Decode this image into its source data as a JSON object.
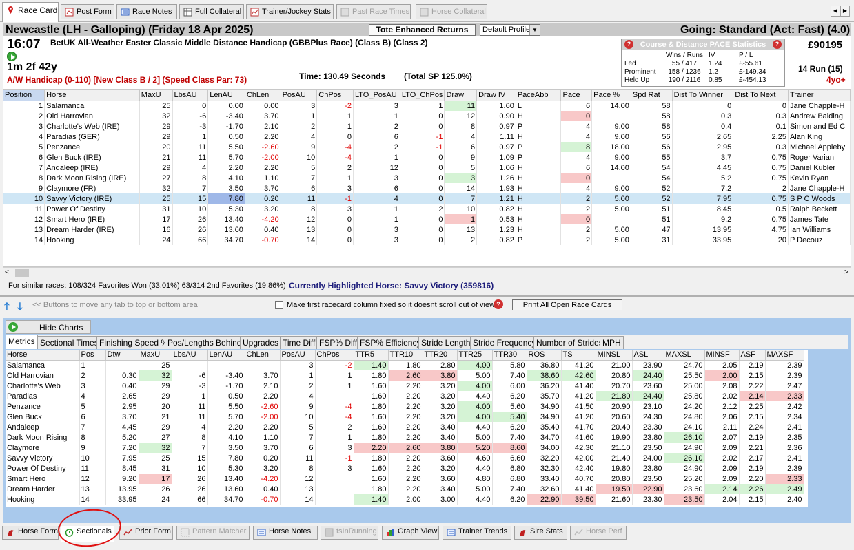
{
  "top_tabs": [
    {
      "label": "Race Card",
      "icon": "location-pin-icon",
      "active": true
    },
    {
      "label": "Post Form",
      "icon": "form-icon"
    },
    {
      "label": "Race Notes",
      "icon": "notes-icon"
    },
    {
      "label": "Full Collateral",
      "icon": "table-icon"
    },
    {
      "label": "Trainer/Jockey Stats",
      "icon": "chart-icon"
    },
    {
      "label": "Past Race Times",
      "icon": "grid-icon",
      "disabled": true
    },
    {
      "label": "Horse Collateral",
      "icon": "grid-icon",
      "disabled": true
    }
  ],
  "header": {
    "course": "Newcastle (LH - Galloping)  (Friday 18 Apr 2025)",
    "tote_button": "Tote Enhanced Returns",
    "profile_select": "Default Profile",
    "going": "Going: Standard (Act: Fast) (4.0)",
    "time": "16:07",
    "race_title": "BetUK All-Weather Easter Classic Middle Distance Handicap (GBBPlus Race) (Class B) (Class 2)",
    "distance": "1m 2f 42y",
    "class_line": "A/W Handicap (0-110) [New Class B / 2]  (Speed Class Par: 73)",
    "race_time": "Time: 130.49 Seconds",
    "total_sp": "(Total SP 125.0%)",
    "prize": "£90195",
    "runners": "14 Run (15)",
    "age": "4yo+"
  },
  "pace_stats": {
    "title": "Course & Distance PACE Statistics",
    "headers": [
      "",
      "Wins / Runs",
      "IV",
      "P / L"
    ],
    "rows": [
      [
        "Led",
        "55 / 417",
        "1.24",
        "£-55.61"
      ],
      [
        "Prominent",
        "158 / 1236",
        "1.2",
        "£-149.34"
      ],
      [
        "Held Up",
        "190 / 2116",
        "0.85",
        "£-454.13"
      ]
    ]
  },
  "racecard": {
    "columns": [
      "Position",
      "Horse",
      "MaxU",
      "LbsAU",
      "LenAU",
      "ChLen",
      "PosAU",
      "ChPos",
      "LTO_PosAU",
      "LTO_ChPos",
      "Draw",
      "Draw IV",
      "PaceAbb",
      "Pace",
      "Pace %",
      "Spd Rat",
      "Dist To Winner",
      "Dist To Next",
      "Trainer"
    ],
    "rows": [
      [
        "1",
        "Salamanca",
        "25",
        "0",
        "0.00",
        "0.00",
        "3",
        "-2",
        "3",
        "1",
        "11",
        "1.60",
        "L",
        "6",
        "14.00",
        "58",
        "0",
        "0",
        "Jane Chapple-H"
      ],
      [
        "2",
        "Old Harrovian",
        "32",
        "-6",
        "-3.40",
        "3.70",
        "1",
        "1",
        "1",
        "0",
        "12",
        "0.90",
        "H",
        "0",
        "",
        "58",
        "0.3",
        "0.3",
        "Andrew Balding"
      ],
      [
        "3",
        "Charlotte's Web (IRE)",
        "29",
        "-3",
        "-1.70",
        "2.10",
        "2",
        "1",
        "2",
        "0",
        "8",
        "0.97",
        "P",
        "4",
        "9.00",
        "58",
        "0.4",
        "0.1",
        "Simon and Ed C"
      ],
      [
        "4",
        "Paradias (GER)",
        "29",
        "1",
        "0.50",
        "2.20",
        "4",
        "0",
        "6",
        "-1",
        "4",
        "1.11",
        "H",
        "4",
        "9.00",
        "56",
        "2.65",
        "2.25",
        "Alan King"
      ],
      [
        "5",
        "Penzance",
        "20",
        "11",
        "5.50",
        "-2.60",
        "9",
        "-4",
        "2",
        "-1",
        "6",
        "0.97",
        "P",
        "8",
        "18.00",
        "56",
        "2.95",
        "0.3",
        "Michael Appleby"
      ],
      [
        "6",
        "Glen Buck (IRE)",
        "21",
        "11",
        "5.70",
        "-2.00",
        "10",
        "-4",
        "1",
        "0",
        "9",
        "1.09",
        "P",
        "4",
        "9.00",
        "55",
        "3.7",
        "0.75",
        "Roger Varian"
      ],
      [
        "7",
        "Andaleep (IRE)",
        "29",
        "4",
        "2.20",
        "2.20",
        "5",
        "2",
        "12",
        "0",
        "5",
        "1.06",
        "H",
        "6",
        "14.00",
        "54",
        "4.45",
        "0.75",
        "Daniel Kubler"
      ],
      [
        "8",
        "Dark Moon Rising (IRE)",
        "27",
        "8",
        "4.10",
        "1.10",
        "7",
        "1",
        "3",
        "0",
        "3",
        "1.26",
        "H",
        "0",
        "",
        "54",
        "5.2",
        "0.75",
        "Kevin Ryan"
      ],
      [
        "9",
        "Claymore (FR)",
        "32",
        "7",
        "3.50",
        "3.70",
        "6",
        "3",
        "6",
        "0",
        "14",
        "1.93",
        "H",
        "4",
        "9.00",
        "52",
        "7.2",
        "2",
        "Jane Chapple-H"
      ],
      [
        "10",
        "Savvy Victory (IRE)",
        "25",
        "15",
        "7.80",
        "0.20",
        "11",
        "-1",
        "4",
        "0",
        "7",
        "1.21",
        "H",
        "2",
        "5.00",
        "52",
        "7.95",
        "0.75",
        "S P C Woods"
      ],
      [
        "11",
        "Power Of Destiny",
        "31",
        "10",
        "5.30",
        "3.20",
        "8",
        "3",
        "1",
        "2",
        "10",
        "0.82",
        "H",
        "2",
        "5.00",
        "51",
        "8.45",
        "0.5",
        "Ralph Beckett"
      ],
      [
        "12",
        "Smart Hero (IRE)",
        "17",
        "26",
        "13.40",
        "-4.20",
        "12",
        "0",
        "1",
        "0",
        "1",
        "0.53",
        "H",
        "0",
        "",
        "51",
        "9.2",
        "0.75",
        "James Tate"
      ],
      [
        "13",
        "Dream Harder (IRE)",
        "16",
        "26",
        "13.60",
        "0.40",
        "13",
        "0",
        "3",
        "0",
        "13",
        "1.23",
        "H",
        "2",
        "5.00",
        "47",
        "13.95",
        "4.75",
        "Ian Williams"
      ],
      [
        "14",
        "Hooking",
        "24",
        "66",
        "34.70",
        "-0.70",
        "14",
        "0",
        "3",
        "0",
        "2",
        "0.82",
        "P",
        "2",
        "5.00",
        "31",
        "33.95",
        "20",
        "P Decouz"
      ]
    ]
  },
  "similar_races": "For similar races: 108/324 Favorites Won (33.01%) 63/314 2nd Favorites (19.86%)",
  "highlighted_horse": "Currently Highlighted Horse:  Savvy Victory (359816)",
  "move_hint": "<< Buttons to move any tab to top or bottom area",
  "fixed_col_label": "Make first racecard column fixed so it doesnt scroll out of view",
  "print_button": "Print All Open Race Cards",
  "hide_charts": "Hide Charts",
  "sub_tabs": [
    "Metrics",
    "Sectional Times",
    "Finishing Speed %",
    "Pos/Lengths Behind",
    "Upgrades",
    "Time Diff",
    "FSP% Diff",
    "FSP% Efficiency",
    "Stride Length",
    "Stride Frequency",
    "Number of Strides",
    "MPH"
  ],
  "metrics": {
    "columns": [
      "Horse",
      "Pos",
      "Dtw",
      "MaxU",
      "LbsAU",
      "LenAU",
      "ChLen",
      "PosAU",
      "ChPos",
      "TTR5",
      "TTR10",
      "TTR20",
      "TTR25",
      "TTR30",
      "ROS",
      "TS",
      "MINSL",
      "ASL",
      "MAXSL",
      "MINSF",
      "ASF",
      "MAXSF"
    ],
    "rows": [
      [
        "Salamanca",
        "1",
        "",
        "25",
        "",
        "",
        "",
        "3",
        "-2",
        "1.40",
        "1.80",
        "2.80",
        "4.00",
        "5.80",
        "36.80",
        "41.20",
        "21.00",
        "23.90",
        "24.70",
        "2.05",
        "2.19",
        "2.39"
      ],
      [
        "Old Harrovian",
        "2",
        "0.30",
        "32",
        "-6",
        "-3.40",
        "3.70",
        "1",
        "1",
        "1.80",
        "2.60",
        "3.80",
        "5.00",
        "7.40",
        "38.60",
        "42.60",
        "20.80",
        "24.40",
        "25.50",
        "2.00",
        "2.15",
        "2.39"
      ],
      [
        "Charlotte's Web",
        "3",
        "0.40",
        "29",
        "-3",
        "-1.70",
        "2.10",
        "2",
        "1",
        "1.60",
        "2.20",
        "3.20",
        "4.00",
        "6.00",
        "36.20",
        "41.40",
        "20.70",
        "23.60",
        "25.00",
        "2.08",
        "2.22",
        "2.47"
      ],
      [
        "Paradias",
        "4",
        "2.65",
        "29",
        "1",
        "0.50",
        "2.20",
        "4",
        "",
        "1.60",
        "2.20",
        "3.20",
        "4.40",
        "6.20",
        "35.70",
        "41.20",
        "21.80",
        "24.40",
        "25.80",
        "2.02",
        "2.14",
        "2.33"
      ],
      [
        "Penzance",
        "5",
        "2.95",
        "20",
        "11",
        "5.50",
        "-2.60",
        "9",
        "-4",
        "1.80",
        "2.20",
        "3.20",
        "4.00",
        "5.60",
        "34.90",
        "41.50",
        "20.90",
        "23.10",
        "24.20",
        "2.12",
        "2.25",
        "2.42"
      ],
      [
        "Glen Buck",
        "6",
        "3.70",
        "21",
        "11",
        "5.70",
        "-2.00",
        "10",
        "-4",
        "1.60",
        "2.20",
        "3.20",
        "4.00",
        "5.40",
        "34.90",
        "41.20",
        "20.60",
        "24.30",
        "24.80",
        "2.06",
        "2.15",
        "2.34"
      ],
      [
        "Andaleep",
        "7",
        "4.45",
        "29",
        "4",
        "2.20",
        "2.20",
        "5",
        "2",
        "1.60",
        "2.20",
        "3.40",
        "4.40",
        "6.20",
        "35.40",
        "41.70",
        "20.40",
        "23.30",
        "24.10",
        "2.11",
        "2.24",
        "2.41"
      ],
      [
        "Dark Moon Rising",
        "8",
        "5.20",
        "27",
        "8",
        "4.10",
        "1.10",
        "7",
        "1",
        "1.80",
        "2.20",
        "3.40",
        "5.00",
        "7.40",
        "34.70",
        "41.60",
        "19.90",
        "23.80",
        "26.10",
        "2.07",
        "2.19",
        "2.35"
      ],
      [
        "Claymore",
        "9",
        "7.20",
        "32",
        "7",
        "3.50",
        "3.70",
        "6",
        "3",
        "2.20",
        "2.60",
        "3.80",
        "5.20",
        "8.60",
        "34.00",
        "42.30",
        "21.10",
        "23.50",
        "24.90",
        "2.09",
        "2.21",
        "2.36"
      ],
      [
        "Savvy Victory",
        "10",
        "7.95",
        "25",
        "15",
        "7.80",
        "0.20",
        "11",
        "-1",
        "1.80",
        "2.20",
        "3.60",
        "4.60",
        "6.60",
        "32.20",
        "42.00",
        "21.40",
        "24.00",
        "26.10",
        "2.02",
        "2.17",
        "2.41"
      ],
      [
        "Power Of Destiny",
        "11",
        "8.45",
        "31",
        "10",
        "5.30",
        "3.20",
        "8",
        "3",
        "1.60",
        "2.20",
        "3.20",
        "4.40",
        "6.80",
        "32.30",
        "42.40",
        "19.80",
        "23.80",
        "24.90",
        "2.09",
        "2.19",
        "2.39"
      ],
      [
        "Smart Hero",
        "12",
        "9.20",
        "17",
        "26",
        "13.40",
        "-4.20",
        "12",
        "",
        "1.60",
        "2.20",
        "3.60",
        "4.80",
        "6.80",
        "33.40",
        "40.70",
        "20.80",
        "23.50",
        "25.20",
        "2.09",
        "2.20",
        "2.33"
      ],
      [
        "Dream Harder",
        "13",
        "13.95",
        "26",
        "26",
        "13.60",
        "0.40",
        "13",
        "",
        "1.80",
        "2.20",
        "3.40",
        "5.00",
        "7.40",
        "32.60",
        "41.40",
        "19.50",
        "22.90",
        "23.60",
        "2.14",
        "2.26",
        "2.49"
      ],
      [
        "Hooking",
        "14",
        "33.95",
        "24",
        "66",
        "34.70",
        "-0.70",
        "14",
        "",
        "1.40",
        "2.00",
        "3.00",
        "4.40",
        "6.20",
        "22.90",
        "39.50",
        "21.60",
        "23.30",
        "23.50",
        "2.04",
        "2.15",
        "2.40"
      ]
    ]
  },
  "bottom_tabs": [
    {
      "label": "Horse Form",
      "icon": "horse-icon"
    },
    {
      "label": "Sectionals",
      "icon": "stopwatch-icon",
      "active": true
    },
    {
      "label": "Prior Form",
      "icon": "trend-icon"
    },
    {
      "label": "Pattern Matcher",
      "icon": "pattern-icon",
      "disabled": true
    },
    {
      "label": "Horse Notes",
      "icon": "notes-icon"
    },
    {
      "label": "tsInRunning",
      "icon": "grid-icon",
      "disabled": true
    },
    {
      "label": "Graph View",
      "icon": "bar-chart-icon"
    },
    {
      "label": "Trainer Trends",
      "icon": "notes-icon"
    },
    {
      "label": "Sire Stats",
      "icon": "horse-icon"
    },
    {
      "label": "Horse Perf",
      "icon": "trend-icon",
      "disabled": true
    }
  ],
  "colors": {
    "green_cell": "#d5f3d5",
    "pink_cell": "#f8c8c8",
    "highlight_row": "#cfe6f5",
    "panel_blue": "#a9c9ec",
    "annotation_red": "#e01010"
  }
}
